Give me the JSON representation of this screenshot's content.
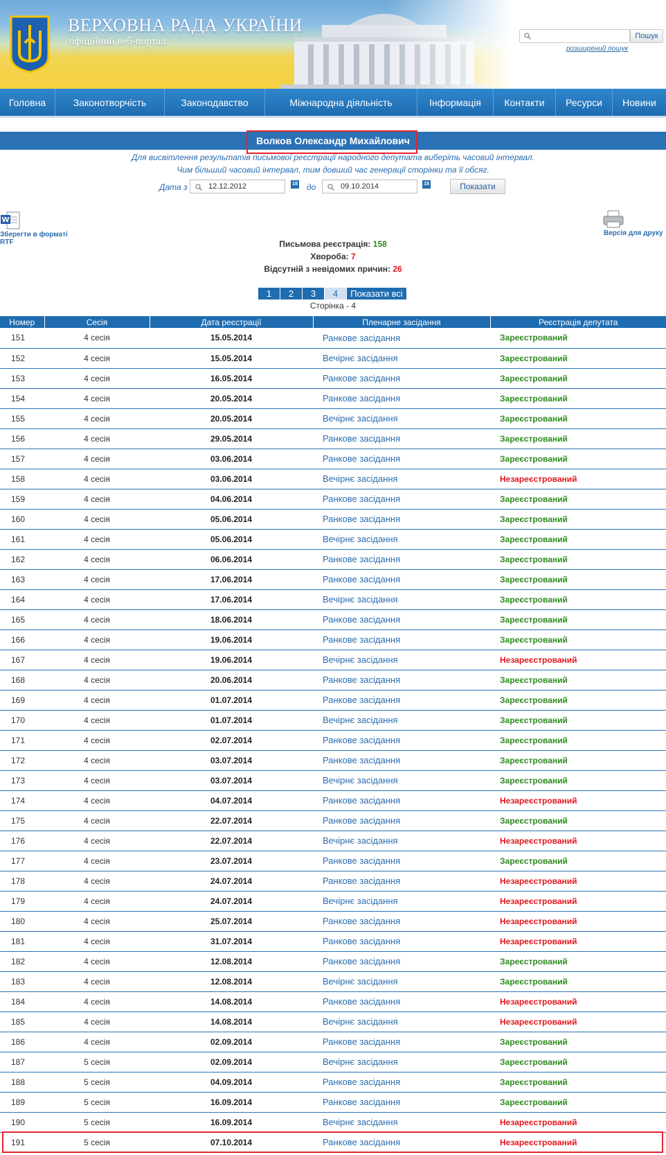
{
  "header": {
    "site_title": "ВЕРХОВНА РАДА УКРАЇНИ",
    "site_subtitle": "офіційний веб-портал",
    "search_placeholder": "",
    "search_button": "Пошук",
    "advanced_search": "розширений пошук"
  },
  "nav": {
    "items": [
      "Головна",
      "Законотворчість",
      "Законодавство",
      "Міжнародна діяльність",
      "Інформація",
      "Контакти",
      "Ресурси",
      "Новини"
    ]
  },
  "person": {
    "name": "Волков Олександр Михайлович"
  },
  "filter": {
    "info_line1": "Для висвітлення результатів письмової реєстрації народного депутата виберіть часовий інтервал.",
    "info_line2": "Чим більший часовий інтервал, тим довший час генерації сторінки та її обсяг.",
    "date_from_label": "Дата з",
    "date_from": "12.12.2012",
    "date_to_label": "до",
    "date_to": "09.10.2014",
    "calendar_icon_text": "18",
    "show_button": "Показати"
  },
  "tools": {
    "rtf_label": "Зберегти в форматі RTF",
    "print_label": "Версія для друку"
  },
  "stats": {
    "written_label": "Письмова реєстрація:",
    "written_value": "158",
    "illness_label": "Хвороба:",
    "illness_value": "7",
    "absent_label": "Відсутній з невідомих причин:",
    "absent_value": "26"
  },
  "pager": {
    "pages": [
      "1",
      "2",
      "3",
      "4"
    ],
    "current": "4",
    "show_all": "Показати всі",
    "caption": "Сторінка - 4"
  },
  "table": {
    "headers": [
      "Номер",
      "Сесія",
      "Дата реєстрації",
      "Пленарне засідання",
      "Реєстрація депутата"
    ],
    "rows": [
      {
        "n": "151",
        "s": "4 сесія",
        "d": "15.05.2014",
        "m": "Ранкове засідання",
        "r": "Зареєстрований",
        "ok": true
      },
      {
        "n": "152",
        "s": "4 сесія",
        "d": "15.05.2014",
        "m": "Вечірнє засідання",
        "r": "Зареєстрований",
        "ok": true
      },
      {
        "n": "153",
        "s": "4 сесія",
        "d": "16.05.2014",
        "m": "Ранкове засідання",
        "r": "Зареєстрований",
        "ok": true
      },
      {
        "n": "154",
        "s": "4 сесія",
        "d": "20.05.2014",
        "m": "Ранкове засідання",
        "r": "Зареєстрований",
        "ok": true
      },
      {
        "n": "155",
        "s": "4 сесія",
        "d": "20.05.2014",
        "m": "Вечірнє засідання",
        "r": "Зареєстрований",
        "ok": true
      },
      {
        "n": "156",
        "s": "4 сесія",
        "d": "29.05.2014",
        "m": "Ранкове засідання",
        "r": "Зареєстрований",
        "ok": true
      },
      {
        "n": "157",
        "s": "4 сесія",
        "d": "03.06.2014",
        "m": "Ранкове засідання",
        "r": "Зареєстрований",
        "ok": true
      },
      {
        "n": "158",
        "s": "4 сесія",
        "d": "03.06.2014",
        "m": "Вечірнє засідання",
        "r": "Незареєстрований",
        "ok": false
      },
      {
        "n": "159",
        "s": "4 сесія",
        "d": "04.06.2014",
        "m": "Ранкове засідання",
        "r": "Зареєстрований",
        "ok": true
      },
      {
        "n": "160",
        "s": "4 сесія",
        "d": "05.06.2014",
        "m": "Ранкове засідання",
        "r": "Зареєстрований",
        "ok": true
      },
      {
        "n": "161",
        "s": "4 сесія",
        "d": "05.06.2014",
        "m": "Вечірнє засідання",
        "r": "Зареєстрований",
        "ok": true
      },
      {
        "n": "162",
        "s": "4 сесія",
        "d": "06.06.2014",
        "m": "Ранкове засідання",
        "r": "Зареєстрований",
        "ok": true
      },
      {
        "n": "163",
        "s": "4 сесія",
        "d": "17.06.2014",
        "m": "Ранкове засідання",
        "r": "Зареєстрований",
        "ok": true
      },
      {
        "n": "164",
        "s": "4 сесія",
        "d": "17.06.2014",
        "m": "Вечірнє засідання",
        "r": "Зареєстрований",
        "ok": true
      },
      {
        "n": "165",
        "s": "4 сесія",
        "d": "18.06.2014",
        "m": "Ранкове засідання",
        "r": "Зареєстрований",
        "ok": true
      },
      {
        "n": "166",
        "s": "4 сесія",
        "d": "19.06.2014",
        "m": "Ранкове засідання",
        "r": "Зареєстрований",
        "ok": true
      },
      {
        "n": "167",
        "s": "4 сесія",
        "d": "19.06.2014",
        "m": "Вечірнє засідання",
        "r": "Незареєстрований",
        "ok": false
      },
      {
        "n": "168",
        "s": "4 сесія",
        "d": "20.06.2014",
        "m": "Ранкове засідання",
        "r": "Зареєстрований",
        "ok": true
      },
      {
        "n": "169",
        "s": "4 сесія",
        "d": "01.07.2014",
        "m": "Ранкове засідання",
        "r": "Зареєстрований",
        "ok": true
      },
      {
        "n": "170",
        "s": "4 сесія",
        "d": "01.07.2014",
        "m": "Вечірнє засідання",
        "r": "Зареєстрований",
        "ok": true
      },
      {
        "n": "171",
        "s": "4 сесія",
        "d": "02.07.2014",
        "m": "Ранкове засідання",
        "r": "Зареєстрований",
        "ok": true
      },
      {
        "n": "172",
        "s": "4 сесія",
        "d": "03.07.2014",
        "m": "Ранкове засідання",
        "r": "Зареєстрований",
        "ok": true
      },
      {
        "n": "173",
        "s": "4 сесія",
        "d": "03.07.2014",
        "m": "Вечірнє засідання",
        "r": "Зареєстрований",
        "ok": true
      },
      {
        "n": "174",
        "s": "4 сесія",
        "d": "04.07.2014",
        "m": "Ранкове засідання",
        "r": "Незареєстрований",
        "ok": false
      },
      {
        "n": "175",
        "s": "4 сесія",
        "d": "22.07.2014",
        "m": "Ранкове засідання",
        "r": "Зареєстрований",
        "ok": true
      },
      {
        "n": "176",
        "s": "4 сесія",
        "d": "22.07.2014",
        "m": "Вечірнє засідання",
        "r": "Незареєстрований",
        "ok": false
      },
      {
        "n": "177",
        "s": "4 сесія",
        "d": "23.07.2014",
        "m": "Ранкове засідання",
        "r": "Зареєстрований",
        "ok": true
      },
      {
        "n": "178",
        "s": "4 сесія",
        "d": "24.07.2014",
        "m": "Ранкове засідання",
        "r": "Незареєстрований",
        "ok": false
      },
      {
        "n": "179",
        "s": "4 сесія",
        "d": "24.07.2014",
        "m": "Вечірнє засідання",
        "r": "Незареєстрований",
        "ok": false
      },
      {
        "n": "180",
        "s": "4 сесія",
        "d": "25.07.2014",
        "m": "Ранкове засідання",
        "r": "Незареєстрований",
        "ok": false
      },
      {
        "n": "181",
        "s": "4 сесія",
        "d": "31.07.2014",
        "m": "Ранкове засідання",
        "r": "Незареєстрований",
        "ok": false
      },
      {
        "n": "182",
        "s": "4 сесія",
        "d": "12.08.2014",
        "m": "Ранкове засідання",
        "r": "Зареєстрований",
        "ok": true
      },
      {
        "n": "183",
        "s": "4 сесія",
        "d": "12.08.2014",
        "m": "Вечірнє засідання",
        "r": "Зареєстрований",
        "ok": true
      },
      {
        "n": "184",
        "s": "4 сесія",
        "d": "14.08.2014",
        "m": "Ранкове засідання",
        "r": "Незареєстрований",
        "ok": false
      },
      {
        "n": "185",
        "s": "4 сесія",
        "d": "14.08.2014",
        "m": "Вечірнє засідання",
        "r": "Незареєстрований",
        "ok": false
      },
      {
        "n": "186",
        "s": "4 сесія",
        "d": "02.09.2014",
        "m": "Ранкове засідання",
        "r": "Зареєстрований",
        "ok": true
      },
      {
        "n": "187",
        "s": "5 сесія",
        "d": "02.09.2014",
        "m": "Вечірнє засідання",
        "r": "Зареєстрований",
        "ok": true
      },
      {
        "n": "188",
        "s": "5 сесія",
        "d": "04.09.2014",
        "m": "Ранкове засідання",
        "r": "Зареєстрований",
        "ok": true
      },
      {
        "n": "189",
        "s": "5 сесія",
        "d": "16.09.2014",
        "m": "Ранкове засідання",
        "r": "Зареєстрований",
        "ok": true
      },
      {
        "n": "190",
        "s": "5 сесія",
        "d": "16.09.2014",
        "m": "Вечірнє засідання",
        "r": "Незареєстрований",
        "ok": false
      },
      {
        "n": "191",
        "s": "5 сесія",
        "d": "07.10.2014",
        "m": "Ранкове засідання",
        "r": "Незареєстрований",
        "ok": false
      }
    ]
  },
  "colors": {
    "registered": "#2e8b1f",
    "unregistered": "#e4161d",
    "accent": "#1f6cb0",
    "highlight": "#e8232e"
  }
}
